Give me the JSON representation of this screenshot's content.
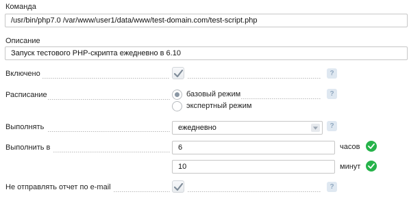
{
  "command": {
    "label": "Команда",
    "value": "/usr/bin/php7.0 /var/www/user1/data/www/test-domain.com/test-script.php"
  },
  "description": {
    "label": "Описание",
    "value": "Запуск тестового PHP-скрипта ежедневно в 6.10"
  },
  "enabled": {
    "label": "Включено",
    "checked": true
  },
  "schedule": {
    "label": "Расписание",
    "options": [
      {
        "label": "базовый режим",
        "selected": true
      },
      {
        "label": "экспертный режим",
        "selected": false
      }
    ]
  },
  "run": {
    "label": "Выполнять",
    "selected": "ежедневно"
  },
  "run_at": {
    "label": "Выполнить в",
    "hours_value": "6",
    "hours_unit": "часов",
    "minutes_value": "10",
    "minutes_unit": "минут"
  },
  "no_email": {
    "label": "Не отправлять отчет по e-mail",
    "checked": true
  },
  "help_glyph": "?",
  "colors": {
    "checkmark": "#7f8c99",
    "ok_green": "#26b34a",
    "help_bg": "#dfe8f1"
  },
  "icons": {
    "check": "checkmark-icon",
    "help": "help-icon",
    "ok": "ok-check-circle-icon",
    "dropdown": "chevron-down-icon"
  }
}
